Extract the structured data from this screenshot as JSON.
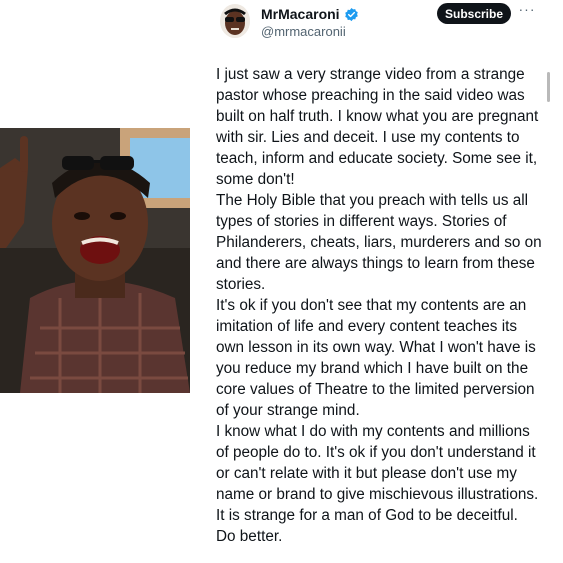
{
  "tweet": {
    "display_name": "MrMacaroni",
    "handle": "@mrmacaronii",
    "subscribe_label": "Subscribe",
    "more_label": "···",
    "verified_color": "#1d9bf0",
    "paragraphs": [
      "I just saw a very strange video from a strange pastor whose preaching in the said video was built on half truth. I know what you are pregnant with sir. Lies and deceit. I use my contents to teach, inform and educate society. Some see it, some don't!",
      "The Holy Bible that you preach with tells us all types of stories in different ways. Stories of Philanderers, cheats, liars, murderers and so on and there are always things to learn from these stories.",
      "It's ok if you don't see that my contents are an imitation of life and every content teaches its own lesson in its own way. What I won't have is you reduce my brand which I have built on the core values of Theatre to the limited perversion of your strange mind.",
      "I know what I do with my contents and millions of people do to. It's ok if you don't understand it or can't relate with it but please don't use my name or brand to give mischievous illustrations. It is strange for a man of God to be deceitful.",
      "Do better."
    ]
  },
  "photo": {
    "subject": "man-shouting-pointing-photo"
  }
}
